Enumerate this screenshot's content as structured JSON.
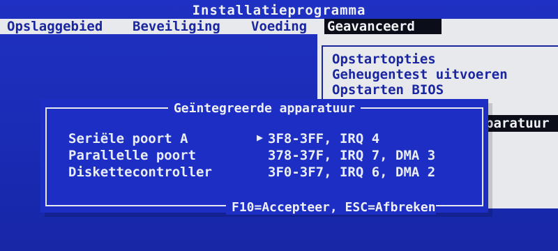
{
  "app": {
    "title": "Installatieprogramma"
  },
  "menubar": {
    "items": [
      {
        "label": "Opslaggebied"
      },
      {
        "label": "Beveiliging"
      },
      {
        "label": "Voeding"
      },
      {
        "label": "Geavanceerd",
        "active": true
      }
    ]
  },
  "submenu": {
    "items": [
      {
        "label": "Opstartopties"
      },
      {
        "label": "Geheugentest uitvoeren"
      },
      {
        "label": "Opstarten BIOS"
      }
    ],
    "highlighted_fragment": "paratuur"
  },
  "dialog": {
    "title": "Geïntegreerde apparatuur",
    "cursor_glyph": "▶",
    "rows": [
      {
        "label": "Seriële poort A",
        "value": "3F8-3FF, IRQ 4",
        "selected": true
      },
      {
        "label": "Parallelle poort",
        "value": "378-37F, IRQ 7, DMA 3"
      },
      {
        "label": "Diskettecontroller",
        "value": "3F0-3F7, IRQ 6, DMA 2"
      }
    ],
    "footer": "F10=Accepteer, ESC=Afbreken"
  },
  "colors": {
    "background": "#1b2bb8",
    "menubar_bg": "#e8e9ed",
    "menu_text": "#1a26a0",
    "active_bg": "#0b0d18",
    "text_light": "#eef0f5"
  }
}
